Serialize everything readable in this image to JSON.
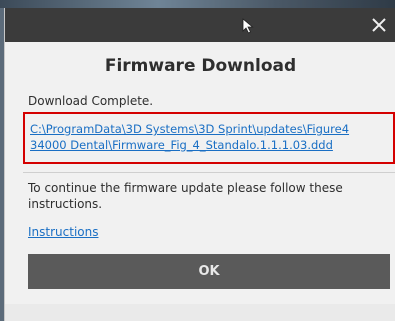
{
  "dialog": {
    "title": "Firmware Download",
    "status": "Download Complete.",
    "file_path_line1": "C:\\ProgramData\\3D Systems\\3D Sprint\\updates\\Figure4",
    "file_path_line2": "34000 Dental\\Firmware_Fig_4_Standalo.1.1.1.03.ddd",
    "instruction": "To continue the firmware update please follow these instructions.",
    "instructions_link": "Instructions",
    "ok_label": "OK",
    "close_glyph": "✕"
  },
  "icons": {
    "close": "close-icon",
    "cursor": "mouse-cursor-icon"
  },
  "colors": {
    "titlebar": "#3b3b3b",
    "dialog_bg": "#f1f1f1",
    "link": "#1a6fc4",
    "highlight": "#d40000",
    "ok_button": "#5a5a5a"
  }
}
